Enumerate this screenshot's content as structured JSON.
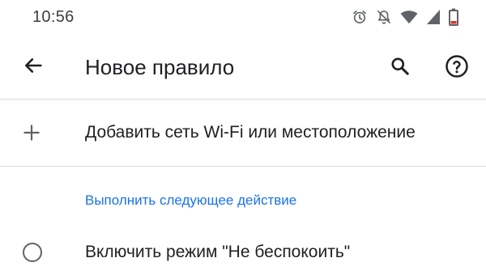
{
  "status_bar": {
    "time": "10:56",
    "icons": [
      "alarm-icon",
      "notifications-off-icon",
      "wifi-icon",
      "signal-icon",
      "battery-low-icon"
    ],
    "battery_color": "#d93025"
  },
  "app_bar": {
    "back_icon": "arrow-back-icon",
    "title": "Новое правило",
    "search_icon": "search-icon",
    "help_icon": "help-icon"
  },
  "add_trigger": {
    "icon": "plus-icon",
    "label": "Добавить сеть Wi-Fi или местоположение"
  },
  "action_section": {
    "header": "Выполнить следующее действие",
    "accent_color": "#1a73e8",
    "options": [
      {
        "label": "Включить режим \"Не беспокоить\"",
        "selected": false
      }
    ]
  }
}
